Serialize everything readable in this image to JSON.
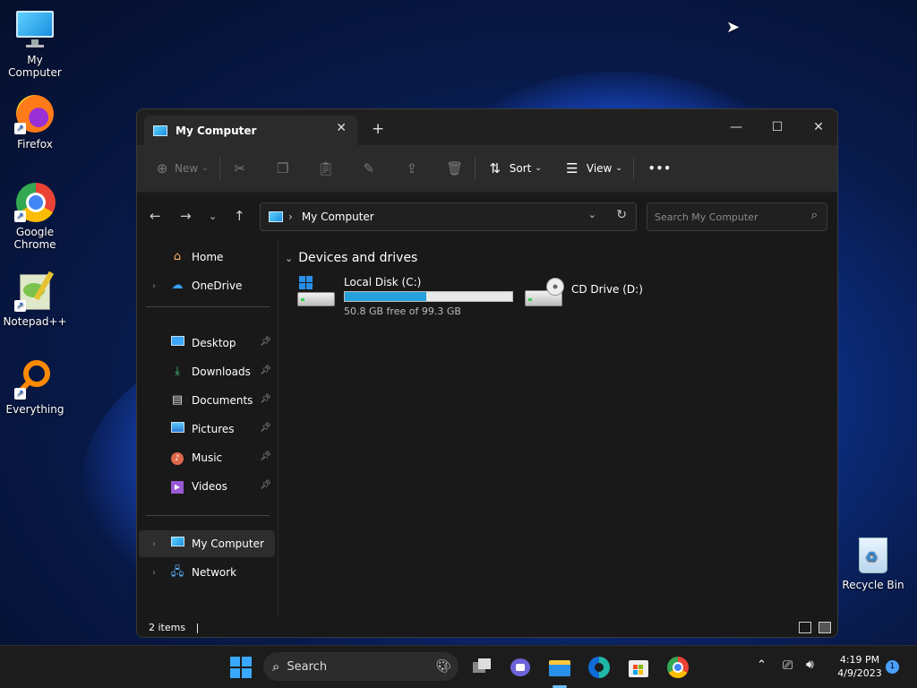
{
  "desktop": {
    "icons": [
      {
        "label": "My Computer"
      },
      {
        "label": "Firefox"
      },
      {
        "label": "Google Chrome"
      },
      {
        "label": "Notepad++"
      },
      {
        "label": "Everything"
      },
      {
        "label": "Recycle Bin"
      }
    ]
  },
  "window": {
    "tab_title": "My Computer",
    "tab_close": "✕",
    "new_tab": "+",
    "controls": {
      "minimize": "—",
      "maximize": "☐",
      "close": "✕"
    },
    "toolbar": {
      "new_label": "New",
      "sort_label": "Sort",
      "view_label": "View",
      "more": "•••"
    },
    "address": {
      "crumb": "My Computer",
      "separator": "›",
      "search_placeholder": "Search My Computer"
    },
    "nav": {
      "items": [
        {
          "label": "Home"
        },
        {
          "label": "OneDrive"
        },
        {
          "label": "Desktop"
        },
        {
          "label": "Downloads"
        },
        {
          "label": "Documents"
        },
        {
          "label": "Pictures"
        },
        {
          "label": "Music"
        },
        {
          "label": "Videos"
        },
        {
          "label": "My Computer"
        },
        {
          "label": "Network"
        }
      ]
    },
    "content": {
      "group_title": "Devices and drives",
      "drives": [
        {
          "name": "Local Disk (C:)",
          "free_text": "50.8 GB free of 99.3 GB",
          "used_fraction": 0.488
        },
        {
          "name": "CD Drive (D:)"
        }
      ]
    },
    "status": {
      "item_count": "2 items",
      "cursor": "|"
    }
  },
  "taskbar": {
    "search_label": "Search",
    "time": "4:19 PM",
    "date": "4/9/2023",
    "notification_count": "1"
  },
  "colors": {
    "accent": "#26a0da",
    "window_bg": "#202020",
    "taskbar_bg": "#1c1c1c"
  }
}
